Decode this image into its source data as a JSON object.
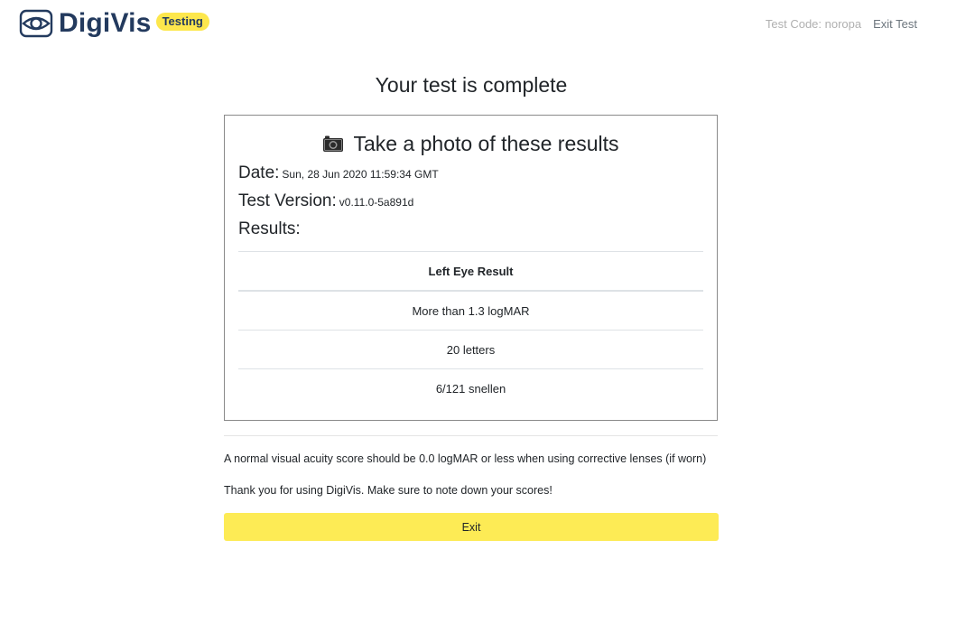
{
  "header": {
    "brand_name": "DigiVis",
    "badge": "Testing",
    "test_code_label": "Test Code: noropa",
    "exit_link": "Exit Test"
  },
  "page_title": "Your test is complete",
  "card": {
    "heading": "Take a photo of these results",
    "heading_icon": "camera-icon",
    "date_label": "Date:",
    "date_value": "Sun, 28 Jun 2020 11:59:34 GMT",
    "version_label": "Test Version:",
    "version_value": "v0.11.0-5a891d",
    "results_label": "Results:",
    "table": {
      "header": "Left Eye Result",
      "rows": [
        "More than 1.3 logMAR",
        "20 letters",
        "6/121 snellen"
      ]
    }
  },
  "notes": [
    "A normal visual acuity score should be 0.0 logMAR or less when using corrective lenses (if worn)",
    "Thank you for using DigiVis. Make sure to note down your scores!"
  ],
  "exit_button": "Exit",
  "colors": {
    "brand": "#233a5e",
    "accent_yellow": "#fde74c",
    "button_yellow": "#fdeb55"
  }
}
